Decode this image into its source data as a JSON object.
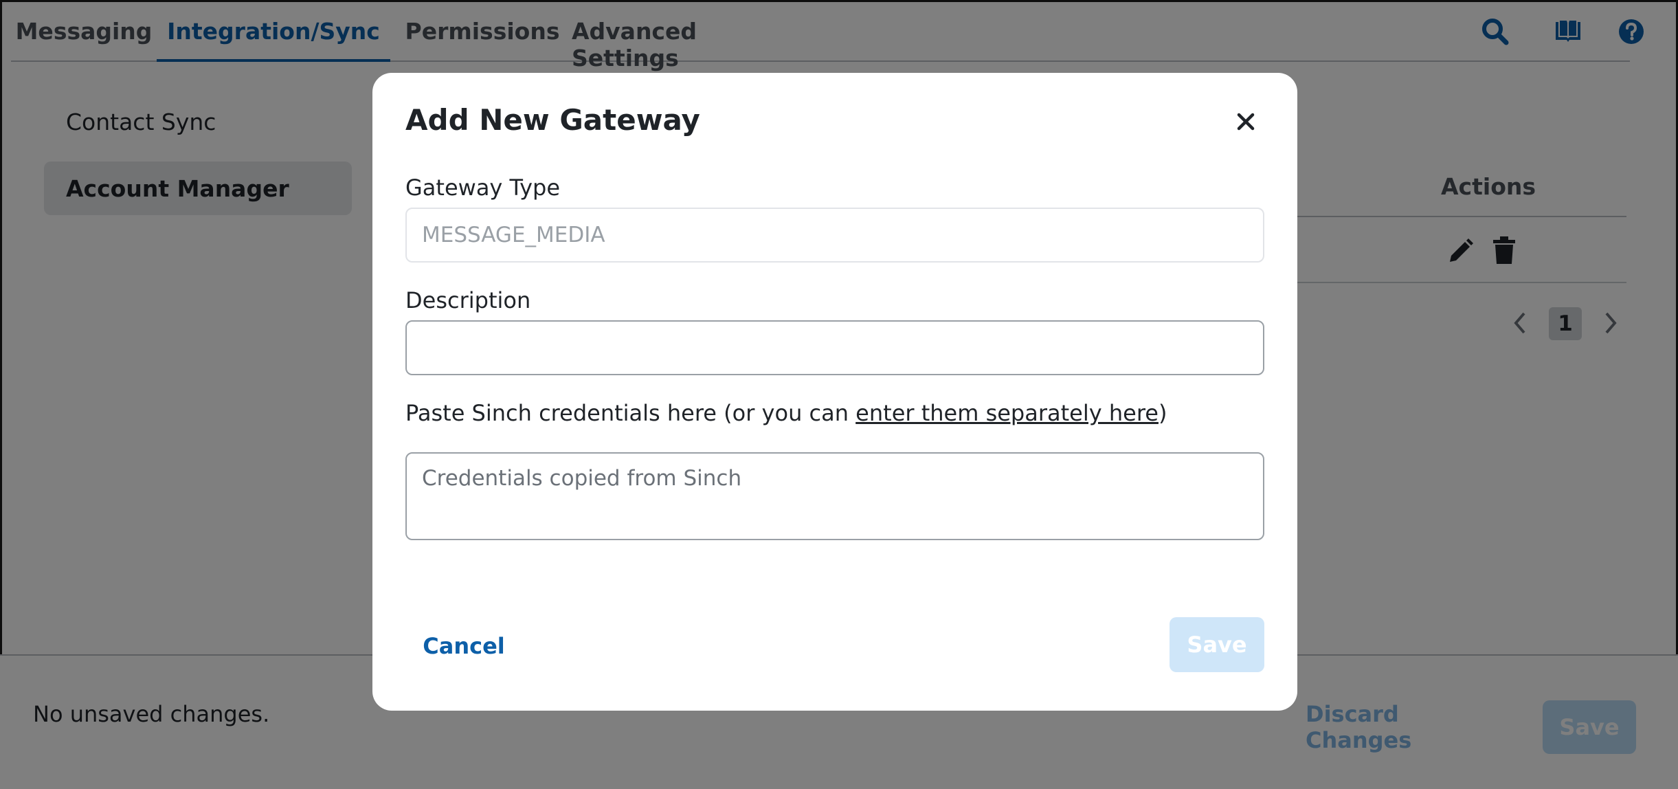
{
  "nav": {
    "tabs": [
      {
        "label": "Messaging",
        "active": false
      },
      {
        "label": "Integration/Sync",
        "active": true
      },
      {
        "label": "Permissions",
        "active": false
      },
      {
        "label": "Advanced Settings",
        "active": false
      }
    ],
    "icons": [
      "search-icon",
      "book-icon",
      "help-icon"
    ]
  },
  "sidebar": {
    "items": [
      {
        "label": "Contact Sync",
        "active": false
      },
      {
        "label": "Account Manager",
        "active": true
      }
    ]
  },
  "table": {
    "actions_header": "Actions",
    "row_icons": [
      "edit-icon",
      "trash-icon"
    ]
  },
  "pager": {
    "current_page": "1"
  },
  "footer": {
    "status": "No unsaved changes.",
    "discard_label": "Discard Changes",
    "save_label": "Save"
  },
  "modal": {
    "title": "Add New Gateway",
    "gateway_type": {
      "label": "Gateway Type",
      "value": "MESSAGE_MEDIA"
    },
    "description": {
      "label": "Description",
      "value": ""
    },
    "credentials": {
      "label_prefix": "Paste Sinch credentials here (or you can ",
      "link_text": "enter them separately here",
      "label_suffix": ")",
      "placeholder": "Credentials copied from Sinch"
    },
    "cancel_label": "Cancel",
    "save_label": "Save"
  },
  "colors": {
    "accent": "#0d5fa8",
    "disabled_button": "#cfe6f9",
    "overlay": "rgba(0,0,0,0.5)"
  }
}
